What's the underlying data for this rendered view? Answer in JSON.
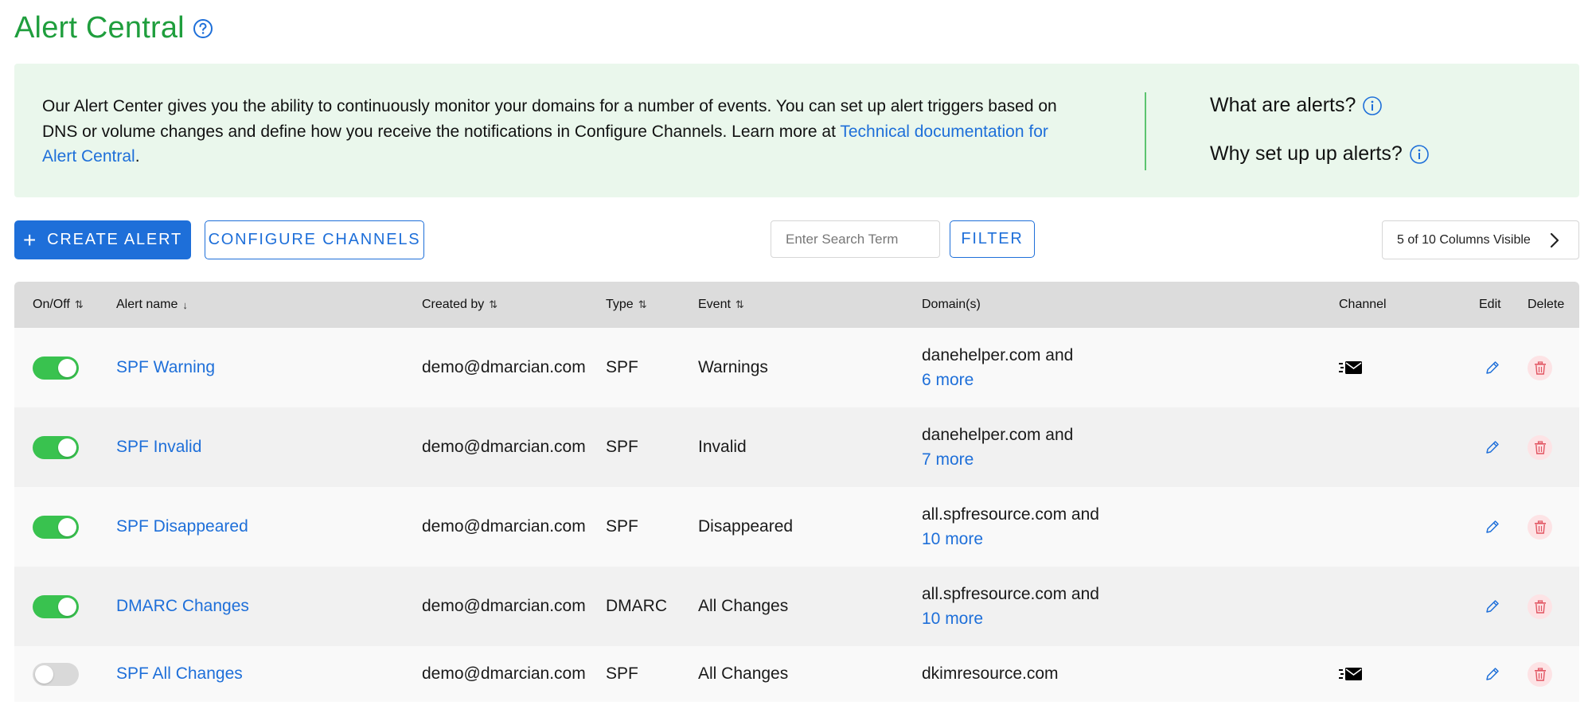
{
  "page": {
    "title": "Alert Central"
  },
  "info": {
    "text_before_link": "Our Alert Center gives you the ability to continuously monitor your domains for a number of events. You can set up alert triggers based on DNS or volume changes and define how you receive the notifications in Configure Channels. Learn more at ",
    "link_text": "Technical documentation for Alert Central",
    "text_after_link": ".",
    "faq_1": "What are alerts?",
    "faq_2": "Why set up up alerts?"
  },
  "toolbar": {
    "create_label": "CREATE ALERT",
    "configure_label": "CONFIGURE CHANNELS",
    "search_placeholder": "Enter Search Term",
    "filter_label": "FILTER",
    "columns_visible": "5 of 10 Columns Visible"
  },
  "table": {
    "headers": {
      "onoff": "On/Off",
      "name": "Alert name",
      "created": "Created by",
      "type": "Type",
      "event": "Event",
      "domains": "Domain(s)",
      "channel": "Channel",
      "edit": "Edit",
      "delete": "Delete"
    },
    "rows": [
      {
        "enabled": true,
        "name": "SPF Warning",
        "created": "demo@dmarcian.com",
        "type": "SPF",
        "event": "Warnings",
        "domain": "danehelper.com and",
        "more": "6 more",
        "channel": "email-icon"
      },
      {
        "enabled": true,
        "name": "SPF Invalid",
        "created": "demo@dmarcian.com",
        "type": "SPF",
        "event": "Invalid",
        "domain": "danehelper.com and",
        "more": "7 more",
        "channel": ""
      },
      {
        "enabled": true,
        "name": "SPF Disappeared",
        "created": "demo@dmarcian.com",
        "type": "SPF",
        "event": "Disappeared",
        "domain": "all.spfresource.com and",
        "more": "10 more",
        "channel": ""
      },
      {
        "enabled": true,
        "name": "DMARC Changes",
        "created": "demo@dmarcian.com",
        "type": "DMARC",
        "event": "All Changes",
        "domain": "all.spfresource.com and",
        "more": "10 more",
        "channel": ""
      },
      {
        "enabled": false,
        "name": "SPF All Changes",
        "created": "demo@dmarcian.com",
        "type": "SPF",
        "event": "All Changes",
        "domain": "dkimresource.com",
        "more": "",
        "channel": "email-icon"
      }
    ]
  },
  "colors": {
    "title_green": "#1f9e3d",
    "accent_blue": "#1e6fd9",
    "toggle_on": "#39c24f",
    "panel_bg": "#eaf7ec"
  }
}
